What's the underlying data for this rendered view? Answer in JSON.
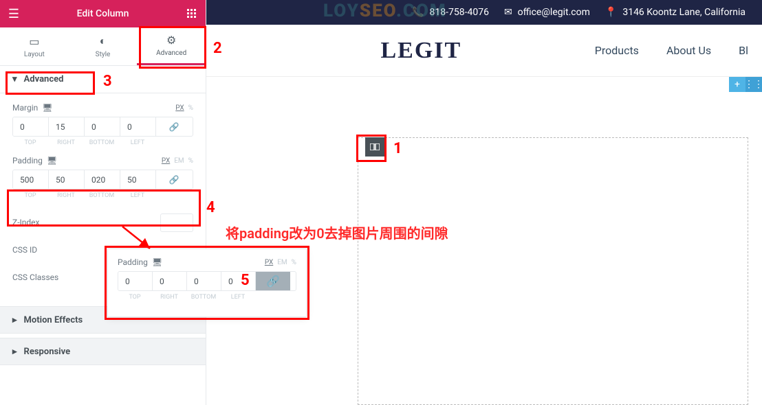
{
  "colors": {
    "accent": "#d6215b",
    "dark": "#1f2545"
  },
  "header": {
    "title": "Edit Column"
  },
  "tabs": [
    "Layout",
    "Style",
    "Advanced"
  ],
  "section": {
    "title": "Advanced"
  },
  "margin": {
    "label": "Margin",
    "units": [
      "PX",
      "%"
    ],
    "values": {
      "top": "0",
      "right": "15",
      "bottom": "0",
      "left": "0"
    },
    "sub": [
      "TOP",
      "RIGHT",
      "BOTTOM",
      "LEFT"
    ]
  },
  "padding": {
    "label": "Padding",
    "units": [
      "PX",
      "EM",
      "%"
    ],
    "values": {
      "top": "500",
      "right": "50",
      "bottom": "020",
      "left": "50"
    },
    "sub": [
      "TOP",
      "RIGHT",
      "BOTTOM",
      "LEFT"
    ]
  },
  "zindex": {
    "label": "Z-Index",
    "value": ""
  },
  "cssid": {
    "label": "CSS ID"
  },
  "cssclasses": {
    "label": "CSS Classes"
  },
  "collapsed": [
    "Motion Effects",
    "Responsive"
  ],
  "popover": {
    "label": "Padding",
    "units": [
      "PX",
      "EM",
      "%"
    ],
    "values": {
      "top": "0",
      "right": "0",
      "bottom": "0",
      "left": "0"
    },
    "sub": [
      "TOP",
      "RIGHT",
      "BOTTOM",
      "LEFT"
    ]
  },
  "top": {
    "phone": "818-758-4076",
    "email": "office@legit.com",
    "addr": "3146 Koontz Lane, California"
  },
  "brand": "LEGIT",
  "nav": [
    "Products",
    "About Us",
    "Bl"
  ],
  "ann": {
    "n1": "1",
    "n2": "2",
    "n3": "3",
    "n4": "4",
    "n5": "5",
    "hint": "将padding改为0去掉图片周围的间隙"
  },
  "wm": {
    "a": "LOY",
    "b": "SEO",
    "c": ".COM"
  }
}
